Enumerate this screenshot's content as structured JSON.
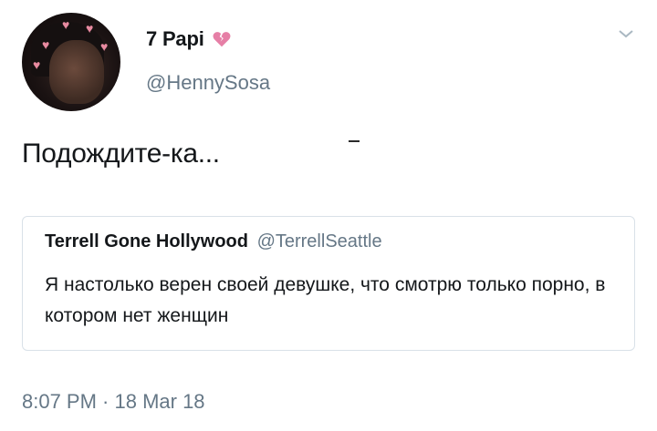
{
  "author": {
    "name": "7 Papi",
    "handle": "@HennySosa",
    "name_emoji": "broken-heart-icon"
  },
  "tweet": {
    "text": "Подождите-ка...",
    "timestamp": "8:07 PM · 18 Mar 18"
  },
  "quoted": {
    "name": "Terrell Gone Hollywood",
    "handle": "@TerrellSeattle",
    "text": "Я настолько верен своей девушке, что смотрю только порно, в котором нет женщин"
  },
  "colors": {
    "secondary_text": "#657786",
    "border": "#d9e1e8",
    "heart": "#e67fa6"
  }
}
